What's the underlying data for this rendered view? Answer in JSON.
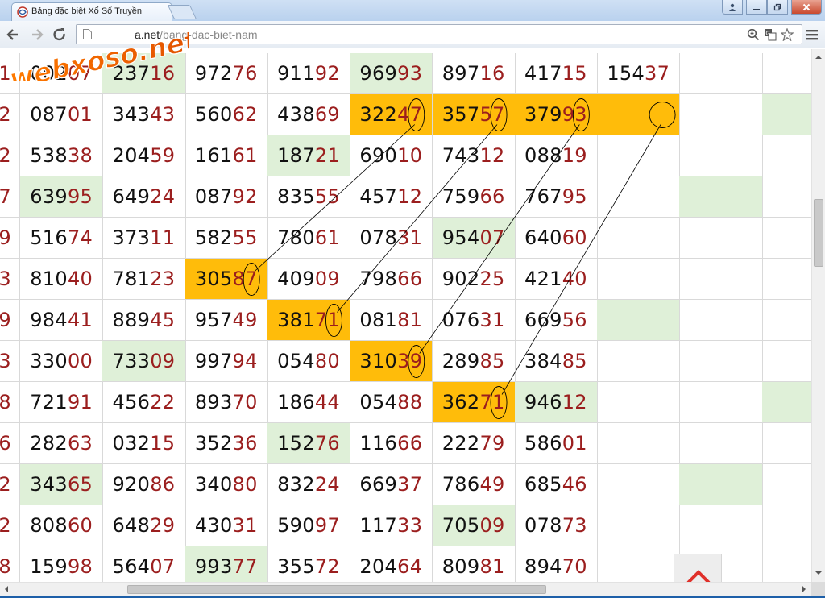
{
  "browser": {
    "tab_title": "Bảng đặc biệt Xổ Số Truyền",
    "url_host": "www.webxoso.net",
    "url_display_prefix": "",
    "url_visible_host": "a.net",
    "url_path": "/bang-dac-biet-nam"
  },
  "watermark": {
    "text": "webxoso.net"
  },
  "table": {
    "left_column": [
      "1",
      "2",
      "2",
      "7",
      "9",
      "3",
      "9",
      "3",
      "8",
      "6",
      "2",
      "2",
      "8"
    ],
    "rows": [
      [
        "00207",
        "23716",
        "97276",
        "91192",
        "96993",
        "89716",
        "41715",
        "15437",
        "",
        ""
      ],
      [
        "08701",
        "34343",
        "56062",
        "43869",
        "32247",
        "35757",
        "37993",
        "",
        "",
        ""
      ],
      [
        "53838",
        "20459",
        "16161",
        "18721",
        "69010",
        "74312",
        "08819",
        "",
        "",
        ""
      ],
      [
        "63995",
        "64924",
        "08792",
        "83555",
        "45712",
        "75966",
        "76795",
        "",
        "",
        ""
      ],
      [
        "51674",
        "37311",
        "58255",
        "78061",
        "07831",
        "95407",
        "64060",
        "",
        "",
        ""
      ],
      [
        "81040",
        "78123",
        "30587",
        "40909",
        "79866",
        "90225",
        "42140",
        "",
        "",
        ""
      ],
      [
        "98441",
        "88945",
        "95749",
        "38171",
        "08181",
        "07631",
        "66956",
        "",
        "",
        ""
      ],
      [
        "33000",
        "73309",
        "99794",
        "05480",
        "31039",
        "28985",
        "38485",
        "",
        "",
        ""
      ],
      [
        "72191",
        "45622",
        "89370",
        "18644",
        "05488",
        "36271",
        "94612",
        "",
        "",
        ""
      ],
      [
        "28263",
        "03215",
        "35236",
        "15276",
        "11666",
        "22279",
        "58601",
        "",
        "",
        ""
      ],
      [
        "34365",
        "92086",
        "34080",
        "83224",
        "66937",
        "78649",
        "68546",
        "",
        "",
        ""
      ],
      [
        "80860",
        "64829",
        "43031",
        "59097",
        "11733",
        "70509",
        "07873",
        "",
        "",
        ""
      ],
      [
        "15998",
        "56407",
        "99377",
        "35572",
        "20464",
        "80981",
        "89470",
        "",
        "",
        ""
      ]
    ],
    "green_cells": [
      [
        0,
        1
      ],
      [
        0,
        4
      ],
      [
        2,
        3
      ],
      [
        3,
        0
      ],
      [
        4,
        5
      ],
      [
        7,
        1
      ],
      [
        8,
        6
      ],
      [
        9,
        3
      ],
      [
        10,
        0
      ],
      [
        11,
        5
      ],
      [
        12,
        2
      ],
      [
        1,
        9
      ],
      [
        3,
        8
      ],
      [
        6,
        7
      ],
      [
        8,
        9
      ],
      [
        10,
        8
      ]
    ],
    "orange_cells": [
      [
        1,
        4
      ],
      [
        1,
        5
      ],
      [
        1,
        6
      ],
      [
        1,
        7
      ],
      [
        5,
        2
      ],
      [
        6,
        3
      ],
      [
        7,
        4
      ],
      [
        8,
        5
      ]
    ],
    "green_color": "#dff0d8",
    "orange_color": "#ffbc0a",
    "tail_color": "#9b1e1e"
  },
  "annotations": {
    "description_links": [
      {
        "from": [
          5,
          2,
          4
        ],
        "to": [
          1,
          4,
          4
        ]
      },
      {
        "from": [
          6,
          3,
          4
        ],
        "to": [
          1,
          5,
          4
        ]
      },
      {
        "from": [
          7,
          4,
          4
        ],
        "to": [
          1,
          6,
          4
        ]
      },
      {
        "from": [
          8,
          5,
          4
        ],
        "to": [
          1,
          7,
          4
        ]
      }
    ]
  },
  "icons": {
    "back": "arrow-left-icon",
    "forward": "arrow-right-icon",
    "reload": "reload-icon",
    "zoom": "zoom-icon",
    "translate": "translate-icon",
    "bookmark": "star-icon",
    "menu": "menu-icon",
    "scroll_top": "chevron-up-icon"
  },
  "scroll_top_color": "#e0302a"
}
